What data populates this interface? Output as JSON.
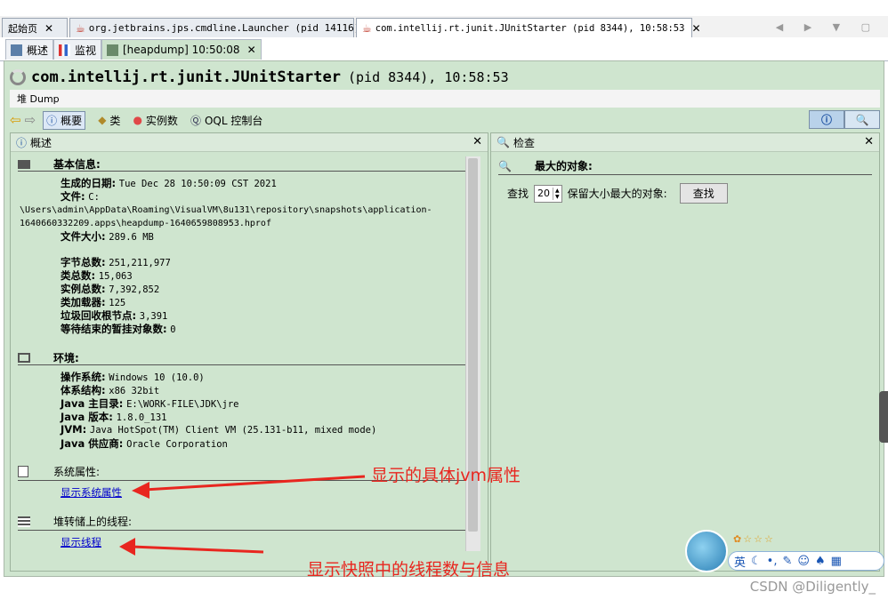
{
  "doc_tabs": [
    {
      "label": "起始页",
      "active": false
    },
    {
      "label": "org.jetbrains.jps.cmdline.Launcher (pid 14116)",
      "active": false
    },
    {
      "label": "com.intellij.rt.junit.JUnitStarter (pid 8344), 10:58:53",
      "active": true
    }
  ],
  "sub_tabs": [
    {
      "label": "概述"
    },
    {
      "label": "监视"
    },
    {
      "label": "[heapdump] 10:50:08"
    }
  ],
  "header": {
    "title": "com.intellij.rt.junit.JUnitStarter",
    "title_suffix": "(pid 8344), 10:58:53",
    "heap_label": "堆 Dump"
  },
  "toolbar": {
    "summary": "概要",
    "classes": "类",
    "instances": "实例数",
    "oql": "OQL 控制台"
  },
  "left_panel": {
    "title": "概述",
    "basic": {
      "heading": "基本信息:",
      "date_label": "生成的日期:",
      "date_value": "Tue Dec 28 10:50:09 CST 2021",
      "file_label": "文件:",
      "file_value_1": "C:",
      "file_value_2": "\\Users\\admin\\AppData\\Roaming\\VisualVM\\8u131\\repository\\snapshots\\application-",
      "file_value_3": "1640660332209.apps\\heapdump-1640659808953.hprof",
      "size_label": "文件大小:",
      "size_value": "289.6 MB",
      "bytes_label": "字节总数:",
      "bytes_value": "251,211,977",
      "classes_label": "类总数:",
      "classes_value": "15,063",
      "instances_label": "实例总数:",
      "instances_value": "7,392,852",
      "loaders_label": "类加载器:",
      "loaders_value": "125",
      "gc_label": "垃圾回收根节点:",
      "gc_value": "3,391",
      "finalize_label": "等待结束的暂挂对象数:",
      "finalize_value": "0"
    },
    "env": {
      "heading": "环境:",
      "os_label": "操作系统:",
      "os_value": "Windows 10 (10.0)",
      "arch_label": "体系结构:",
      "arch_value": "x86 32bit",
      "home_label": "Java 主目录:",
      "home_value": "E:\\WORK-FILE\\JDK\\jre",
      "ver_label": "Java 版本:",
      "ver_value": "1.8.0_131",
      "jvm_label": "JVM:",
      "jvm_value": "Java HotSpot(TM) Client VM (25.131-b11, mixed mode)",
      "vendor_label": "Java 供应商:",
      "vendor_value": "Oracle Corporation"
    },
    "sysprops": {
      "heading": "系统属性:",
      "link": "显示系统属性"
    },
    "threads": {
      "heading": "堆转储上的线程:",
      "link": "显示线程"
    }
  },
  "right_panel": {
    "title": "检查",
    "heading": "最大的对象:",
    "find_label": "查找",
    "count_value": "20",
    "desc": "保留大小最大的对象:",
    "find_button": "查找"
  },
  "annotations": {
    "a1": "显示的具体jvm属性",
    "a2": "显示快照中的线程数与信息"
  },
  "ime": {
    "lang": "英",
    "stars": "☆☆☆"
  },
  "watermark": "CSDN @Diligently_",
  "colors": {
    "panel_bg": "#cfe5cf",
    "link": "#0000cc",
    "annotation": "#e8261f"
  }
}
